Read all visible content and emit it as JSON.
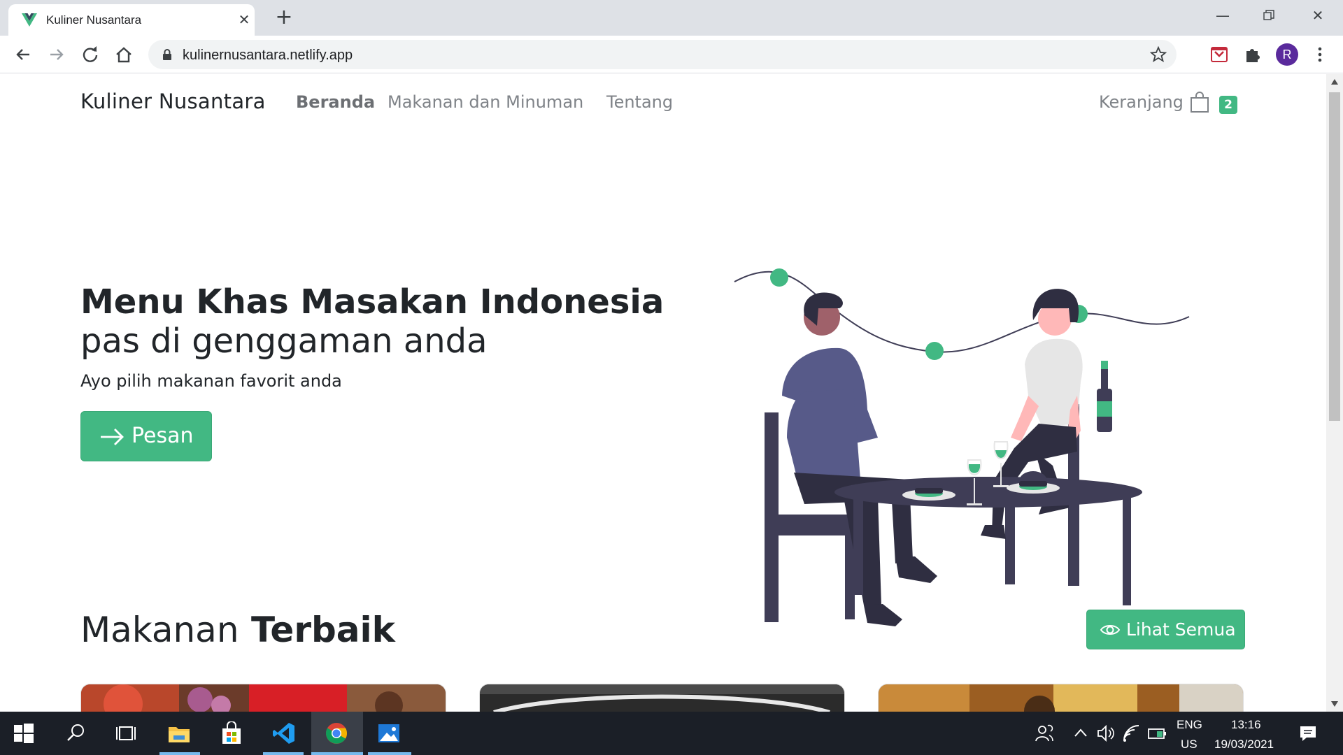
{
  "browser": {
    "tab_title": "Kuliner Nusantara",
    "url": "kulinernusantara.netlify.app",
    "profile_initial": "R"
  },
  "navbar": {
    "brand": "Kuliner Nusantara",
    "links": [
      "Beranda",
      "Makanan dan Minuman",
      "Tentang"
    ],
    "active": "Beranda",
    "cart_label": "Keranjang",
    "cart_count": "2"
  },
  "hero": {
    "title": "Menu Khas Masakan Indonesia",
    "subtitle": "pas di genggaman anda",
    "text": "Ayo pilih makanan favorit anda",
    "button": "Pesan"
  },
  "best": {
    "title_light": "Makanan",
    "title_bold": "Terbaik",
    "button": "Lihat Semua"
  },
  "taskbar": {
    "lang_top": "ENG",
    "lang_bottom": "US",
    "time": "13:16",
    "date": "19/03/2021"
  },
  "colors": {
    "accent": "#42b883",
    "text": "#212529",
    "nav": "#7f8388",
    "taskbar": "#1b1f27"
  }
}
